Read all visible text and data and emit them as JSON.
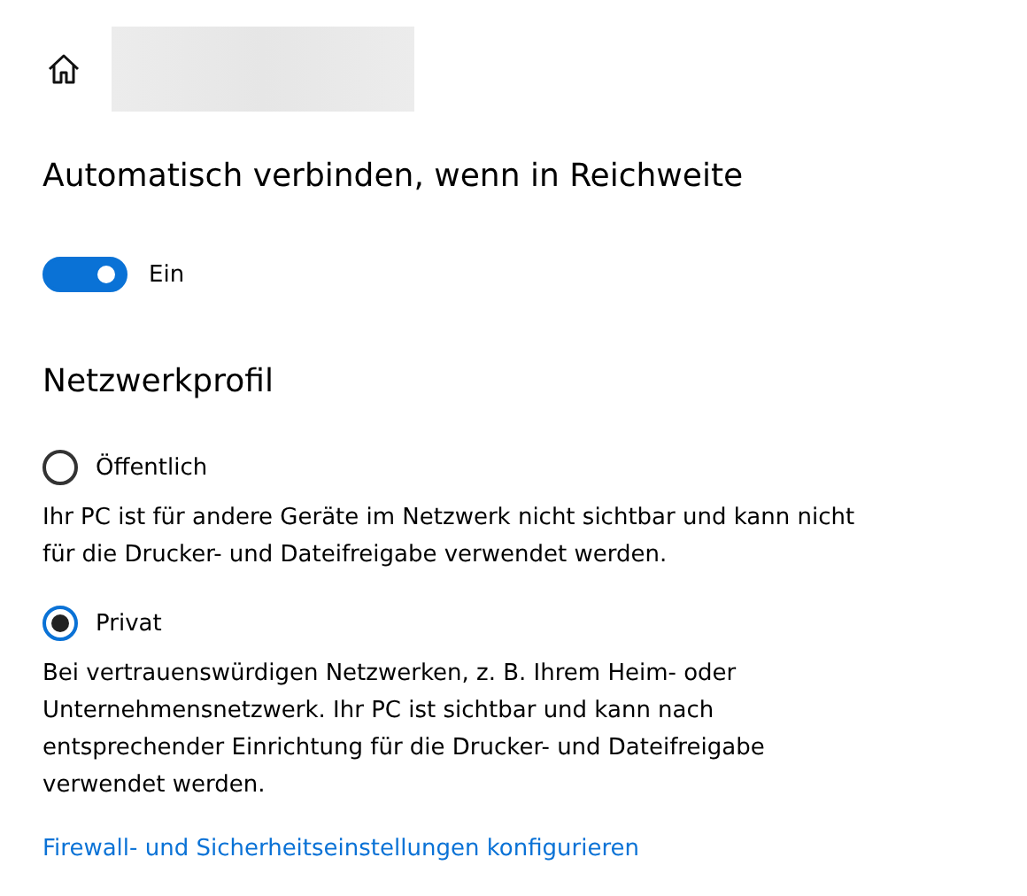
{
  "header": {
    "kind": "redacted"
  },
  "auto_connect": {
    "title": "Automatisch verbinden, wenn in Reichweite",
    "toggle": {
      "on": true,
      "label": "Ein"
    }
  },
  "network_profile": {
    "title": "Netzwerkprofil",
    "options": [
      {
        "label": "Öffentlich",
        "selected": false,
        "description": "Ihr PC ist für andere Geräte im Netzwerk nicht sichtbar und kann nicht für die Drucker- und Dateifreigabe verwendet werden."
      },
      {
        "label": "Privat",
        "selected": true,
        "description": "Bei vertrauenswürdigen Netzwerken, z. B. Ihrem Heim- oder Unternehmensnetzwerk. Ihr PC ist sichtbar und kann nach entsprechender Einrichtung für die Drucker- und Dateifreigabe verwendet werden."
      }
    ]
  },
  "link": "Firewall- und Sicherheitseinstellungen konfigurieren"
}
